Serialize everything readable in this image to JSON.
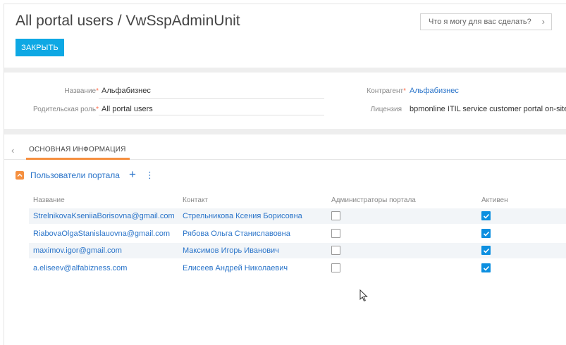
{
  "header": {
    "title": "All portal users / VwSspAdminUnit",
    "close_label": "ЗАКРЫТЬ",
    "help_placeholder": "Что я могу для вас сделать?"
  },
  "fields": {
    "name_label": "Название",
    "name_value": "Альфабизнес",
    "parent_role_label": "Родительская роль",
    "parent_role_value": "All portal users",
    "account_label": "Контрагент",
    "account_value": "Альфабизнес",
    "license_label": "Лицензия",
    "license_value": "bpmonline ITIL service customer portal on-site"
  },
  "tabs": {
    "active_label": "ОСНОВНАЯ ИНФОРМАЦИЯ"
  },
  "detail": {
    "title": "Пользователи портала",
    "columns": [
      "Название",
      "Контакт",
      "Администраторы портала",
      "Активен"
    ],
    "rows": [
      {
        "name": "StrelnikovaKseniiaBorisovna@gmail.com",
        "contact": "Стрельникова Ксения Борисовна",
        "admin": false,
        "active": true
      },
      {
        "name": "RiabovaOlgaStanislauovna@gmail.com",
        "contact": "Рябова Ольга Станиславовна",
        "admin": false,
        "active": true
      },
      {
        "name": "maximov.igor@gmail.com",
        "contact": "Максимов Игорь Иванович",
        "admin": false,
        "active": true
      },
      {
        "name": "a.eliseev@alfabizness.com",
        "contact": "Елисеев Андрей Николаевич",
        "admin": false,
        "active": true
      }
    ]
  },
  "colors": {
    "accent_blue": "#0ea8e4",
    "link_blue": "#2a74c9",
    "orange": "#f58f3f",
    "checkbox_checked": "#0c8fe0"
  },
  "icons": [
    "chevron-right-icon",
    "chevron-left-icon",
    "collapse-icon",
    "add-icon",
    "menu-dots-icon",
    "mouse-cursor-icon"
  ]
}
